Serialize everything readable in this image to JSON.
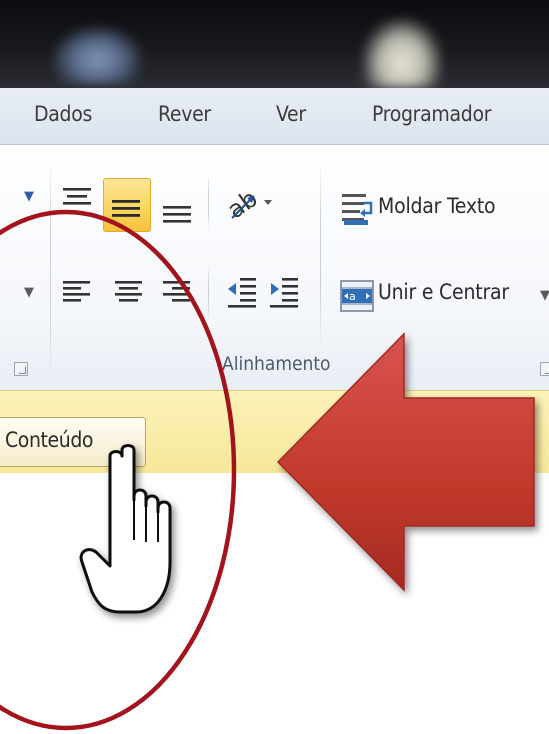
{
  "tabs": [
    "Dados",
    "Rever",
    "Ver",
    "Programador"
  ],
  "ribbon": {
    "wrap_text_label": "Moldar Texto",
    "merge_center_label": "Unir e Centrar",
    "alignment_group_label": "Alinhamento"
  },
  "message_bar": {
    "enable_content_label": "Conteúdo"
  },
  "colors": {
    "arrow": "#c0392b",
    "circle": "#a3131b",
    "message_bar": "#f8ecaa",
    "active_button": "#fbd561"
  },
  "icons": [
    "align-top-icon",
    "align-middle-icon",
    "align-bottom-icon",
    "text-orientation-icon",
    "wrap-text-icon",
    "align-left-icon",
    "align-center-icon",
    "align-right-icon",
    "decrease-indent-icon",
    "increase-indent-icon",
    "merge-center-icon",
    "dialog-launcher-icon",
    "hand-cursor-icon",
    "red-arrow-icon",
    "red-circle-annotation"
  ]
}
